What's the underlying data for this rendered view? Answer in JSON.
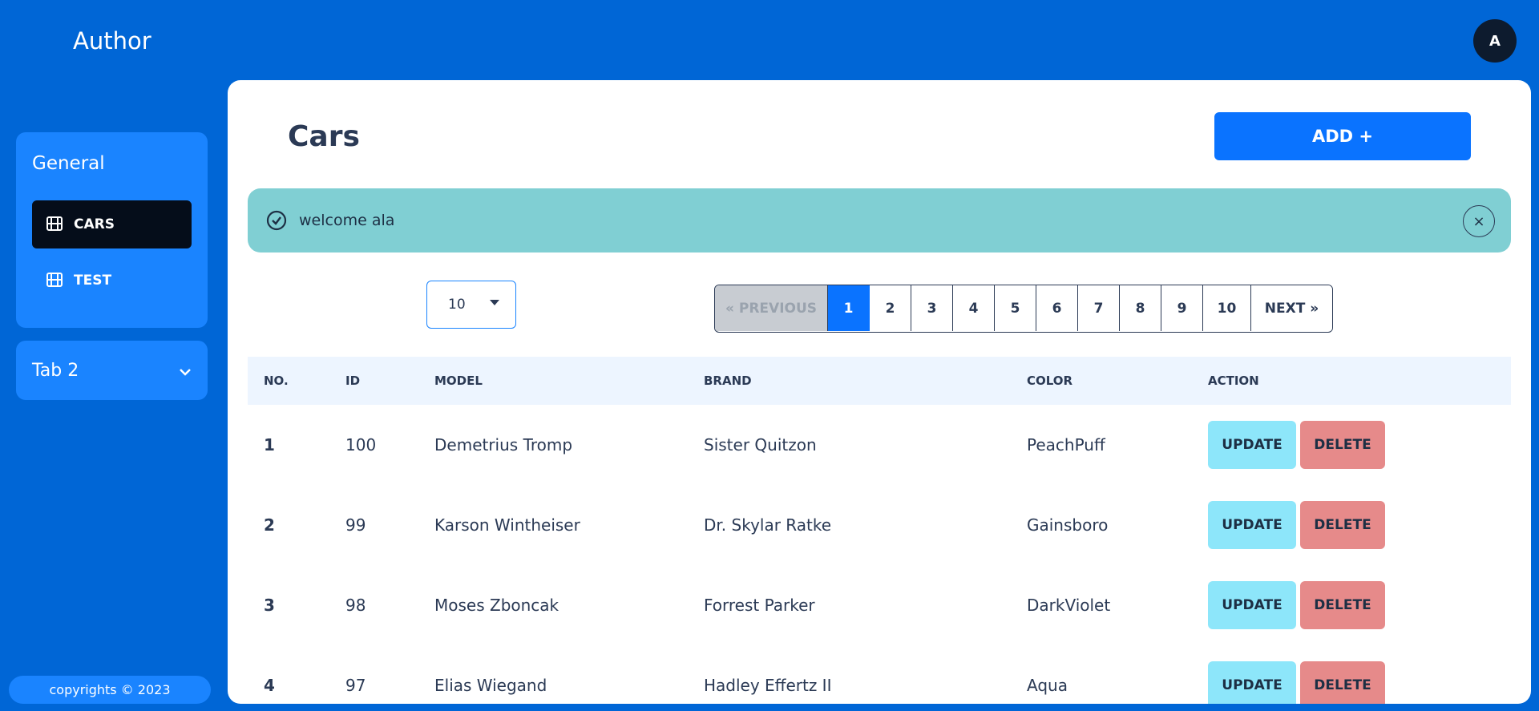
{
  "header": {
    "app_title": "Author",
    "avatar_initial": "A"
  },
  "sidebar": {
    "group_title": "General",
    "items": [
      {
        "label": "CARS",
        "icon": "film-icon",
        "active": true
      },
      {
        "label": "TEST",
        "icon": "film-icon",
        "active": false
      }
    ],
    "tab2_label": "Tab 2",
    "footer": "copyrights © 2023"
  },
  "main": {
    "title": "Cars",
    "add_label": "ADD +",
    "alert": {
      "message": "welcome ala",
      "close": "×"
    },
    "page_size": "10",
    "pagination": {
      "prev": "« PREVIOUS",
      "pages": [
        "1",
        "2",
        "3",
        "4",
        "5",
        "6",
        "7",
        "8",
        "9",
        "10"
      ],
      "current": "1",
      "next": "NEXT »"
    },
    "table": {
      "headers": [
        "NO.",
        "ID",
        "MODEL",
        "BRAND",
        "COLOR",
        "ACTION"
      ],
      "rows": [
        {
          "no": "1",
          "id": "100",
          "model": "Demetrius Tromp",
          "brand": "Sister Quitzon",
          "color": "PeachPuff"
        },
        {
          "no": "2",
          "id": "99",
          "model": "Karson Wintheiser",
          "brand": "Dr. Skylar Ratke",
          "color": "Gainsboro"
        },
        {
          "no": "3",
          "id": "98",
          "model": "Moses Zboncak",
          "brand": "Forrest Parker",
          "color": "DarkViolet"
        },
        {
          "no": "4",
          "id": "97",
          "model": "Elias Wiegand",
          "brand": "Hadley Effertz II",
          "color": "Aqua"
        }
      ],
      "update_label": "UPDATE",
      "delete_label": "DELETE"
    }
  },
  "colors": {
    "background": "#0066d6",
    "accent": "#0a73ff",
    "alert": "#80cfd3",
    "update": "#8de6fa",
    "delete": "#e68a8a"
  }
}
